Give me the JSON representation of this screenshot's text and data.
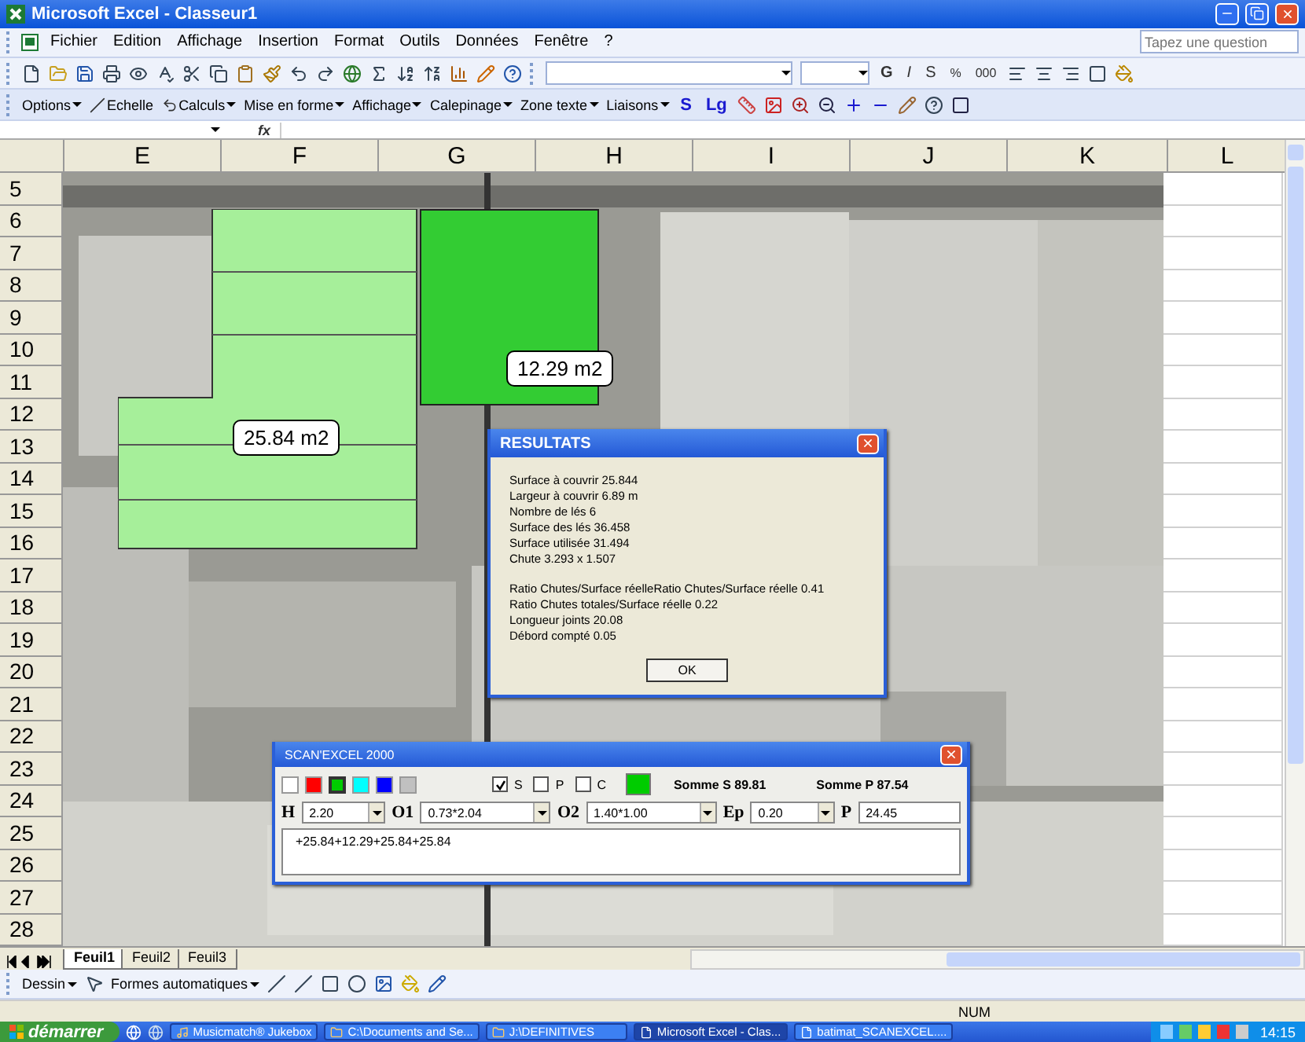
{
  "window": {
    "title": "Microsoft Excel - Classeur1"
  },
  "menu": {
    "items": [
      "Fichier",
      "Edition",
      "Affichage",
      "Insertion",
      "Format",
      "Outils",
      "Données",
      "Fenêtre",
      "?"
    ],
    "help_placeholder": "Tapez une question"
  },
  "format_toolbar": {
    "buttons": [
      "G",
      "I",
      "S",
      "%",
      "000"
    ]
  },
  "plan_toolbar": {
    "items": [
      {
        "label": "Options",
        "dropdown": true
      },
      {
        "label": "Echelle",
        "dropdown": false
      },
      {
        "label": "Calculs",
        "dropdown": true
      },
      {
        "label": "Mise en forme",
        "dropdown": true
      },
      {
        "label": "Affichage",
        "dropdown": true
      },
      {
        "label": "Calepinage",
        "dropdown": true
      },
      {
        "label": "Zone texte",
        "dropdown": true
      },
      {
        "label": "Liaisons",
        "dropdown": true
      }
    ],
    "text_buttons": [
      "S",
      "Lg"
    ]
  },
  "formula_bar": {
    "function_label": "fx"
  },
  "columns": [
    "E",
    "F",
    "G",
    "H",
    "I",
    "J",
    "K",
    "L"
  ],
  "rows": [
    "5",
    "6",
    "7",
    "8",
    "9",
    "10",
    "11",
    "12",
    "13",
    "14",
    "15",
    "16",
    "17",
    "18",
    "19",
    "20",
    "21",
    "22",
    "23",
    "24",
    "25",
    "26",
    "27",
    "28"
  ],
  "plan": {
    "callouts": [
      "12.29 m2",
      "25.84 m2"
    ]
  },
  "results_dialog": {
    "title": "RESULTATS",
    "groups": [
      [
        "Surface à couvrir 25.844",
        "Largeur à couvrir 6.89 m",
        "Nombre de lés  6",
        "Surface des lés 36.458",
        "Surface utilisée 31.494",
        "Chute 3.293 x 1.507"
      ],
      [
        "Ratio Chutes/Surface réelleRatio Chutes/Surface réelle 0.41",
        "Ratio Chutes totales/Surface réelle 0.22",
        "Longueur joints 20.08",
        "Débord compté 0.05"
      ]
    ],
    "button": "OK"
  },
  "scan_dialog": {
    "title": "SCAN'EXCEL 2000",
    "swatches": [
      {
        "color": "#ffffff",
        "selected": false
      },
      {
        "color": "#ff0000",
        "selected": false
      },
      {
        "color": "#00cc00",
        "selected": true
      },
      {
        "color": "#00ffff",
        "selected": false
      },
      {
        "color": "#0000ff",
        "selected": false
      },
      {
        "color": "#c0c0c0",
        "selected": false
      }
    ],
    "checkboxes": [
      {
        "label": "S",
        "checked": true
      },
      {
        "label": "P",
        "checked": false
      },
      {
        "label": "C",
        "checked": false
      }
    ],
    "sums": [
      "Somme S 89.81",
      "Somme P 87.54"
    ],
    "fields": [
      {
        "label": "H",
        "value": "2.20",
        "kind": "combo"
      },
      {
        "label": "O1",
        "value": "0.73*2.04",
        "kind": "combo"
      },
      {
        "label": "O2",
        "value": "1.40*1.00",
        "kind": "combo"
      },
      {
        "label": "Ep",
        "value": "0.20",
        "kind": "combo"
      },
      {
        "label": "P",
        "value": "24.45",
        "kind": "text"
      }
    ],
    "formula": "+25.84+12.29+25.84+25.84"
  },
  "sheet_tabs": [
    {
      "label": "Feuil1",
      "selected": true
    },
    {
      "label": "Feuil2",
      "selected": false
    },
    {
      "label": "Feuil3",
      "selected": false
    }
  ],
  "drawing_toolbar": {
    "items": [
      {
        "label": "Dessin",
        "dropdown": true
      },
      {
        "label": "Formes automatiques",
        "dropdown": true
      }
    ]
  },
  "status_bar": {
    "indicator": "NUM"
  },
  "taskbar": {
    "start": "démarrer",
    "tasks": [
      {
        "label": "Musicmatch® Jukebox",
        "active": false
      },
      {
        "label": "C:\\Documents and Se...",
        "active": false
      },
      {
        "label": "J:\\DEFINITIVES",
        "active": false
      },
      {
        "label": "Microsoft Excel - Clas...",
        "active": true
      },
      {
        "label": "batimat_SCANEXCEL....",
        "active": false
      }
    ],
    "clock": "14:15"
  }
}
